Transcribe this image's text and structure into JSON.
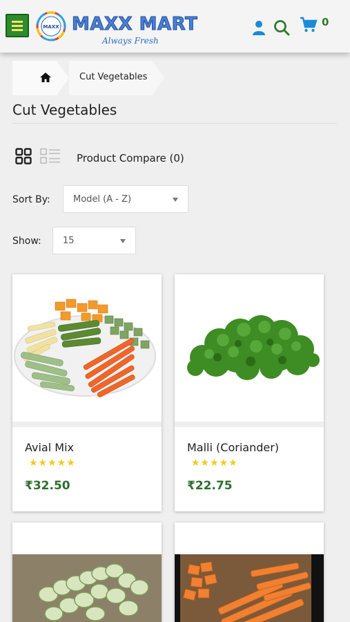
{
  "header": {
    "brand": "MAXX MART",
    "tagline": "Always Fresh",
    "logo_badge": "MAXX",
    "cart_count": "0",
    "icons": [
      "menu-icon",
      "user-icon",
      "search-icon",
      "cart-icon"
    ]
  },
  "breadcrumb": {
    "home_icon": "home-icon",
    "current": "Cut Vegetables"
  },
  "page": {
    "title": "Cut Vegetables"
  },
  "toolbar": {
    "compare_label": "Product Compare (0)",
    "sort_label": "Sort By:",
    "sort_value": "Model (A - Z)",
    "show_label": "Show:",
    "show_value": "15"
  },
  "products": [
    {
      "name": "Avial Mix",
      "price": "₹32.50",
      "stars": "★★★★★",
      "rating": 5
    },
    {
      "name": "Malli (Coriander)",
      "price": "₹22.75",
      "stars": "★★★★★",
      "rating": 5
    },
    {
      "name": "",
      "price": "",
      "stars": "",
      "rating": null
    },
    {
      "name": "",
      "price": "",
      "stars": "",
      "rating": null
    }
  ],
  "colors": {
    "accent_green": "#2e6e2e",
    "brand_blue": "#4a7fd4",
    "star_yellow": "#f3cb1a"
  }
}
